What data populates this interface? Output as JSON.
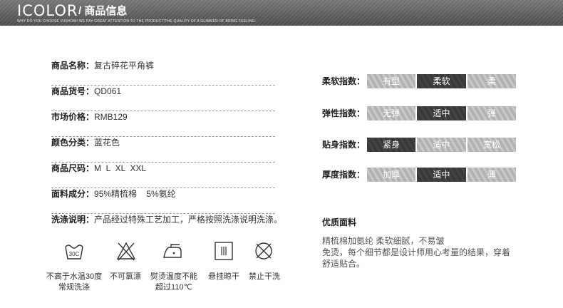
{
  "header": {
    "brand": "ICOLOR",
    "title": "/ 商品信息",
    "tagline": "WHY DO YOU CHOOSE VIISHOW! WE PAY GREAT ATTENTION TO THE PRODUCT!THE QUALITY OF A GLIMMER OF BRING FEELING."
  },
  "specs": [
    {
      "label": "商品名称：",
      "value": "复古碎花平角裤"
    },
    {
      "label": "商品货号：",
      "value": "QD061"
    },
    {
      "label": "市场价格：",
      "value": "RMB129"
    },
    {
      "label": "颜色分类：",
      "value": "蓝花色"
    },
    {
      "label": "商品尺码：",
      "value": "M  L  XL  XXL"
    },
    {
      "label": "面料成分：",
      "value": "95%精梳棉    5%氨纶"
    },
    {
      "label": "洗涤说明：",
      "value": "产品经过特殊工艺加工，严格按照洗涤说明洗涤。"
    }
  ],
  "care": [
    {
      "icon": "wash-30-icon",
      "icon_text": "30C",
      "line1": "不高于水温30度",
      "line2": "常规洗涤"
    },
    {
      "icon": "no-bleach-icon",
      "line1": "不可氯漂",
      "line2": ""
    },
    {
      "icon": "iron-icon",
      "line1": "熨烫温度不能",
      "line2": "超过110℃"
    },
    {
      "icon": "hang-dry-icon",
      "line1": "悬挂晾干",
      "line2": ""
    },
    {
      "icon": "no-dry-clean-icon",
      "line1": "禁止干洗",
      "line2": ""
    }
  ],
  "indices": [
    {
      "label": "柔软指数：",
      "options": [
        "有型",
        "柔软",
        "柔"
      ],
      "active": 1
    },
    {
      "label": "弹性指数：",
      "options": [
        "无弹",
        "适中",
        "弹"
      ],
      "active": 1
    },
    {
      "label": "贴身指数：",
      "options": [
        "紧身",
        "适中",
        "宽松"
      ],
      "active": 0
    },
    {
      "label": "厚度指数：",
      "options": [
        "加厚",
        "适中",
        "薄"
      ],
      "active": 1
    }
  ],
  "quality": {
    "title": "优质面料",
    "line1": "精梳棉加氨纶 柔软细腻，不易皱",
    "line2": "免烫，每个细节都是设计师用心考量的结果，穿着",
    "line3": "舒适贴合。"
  },
  "colors": {
    "header_dark": "#4f4f4f",
    "active_cell": "#3c3c3c",
    "inactive_cell": "#bdbdbd"
  }
}
